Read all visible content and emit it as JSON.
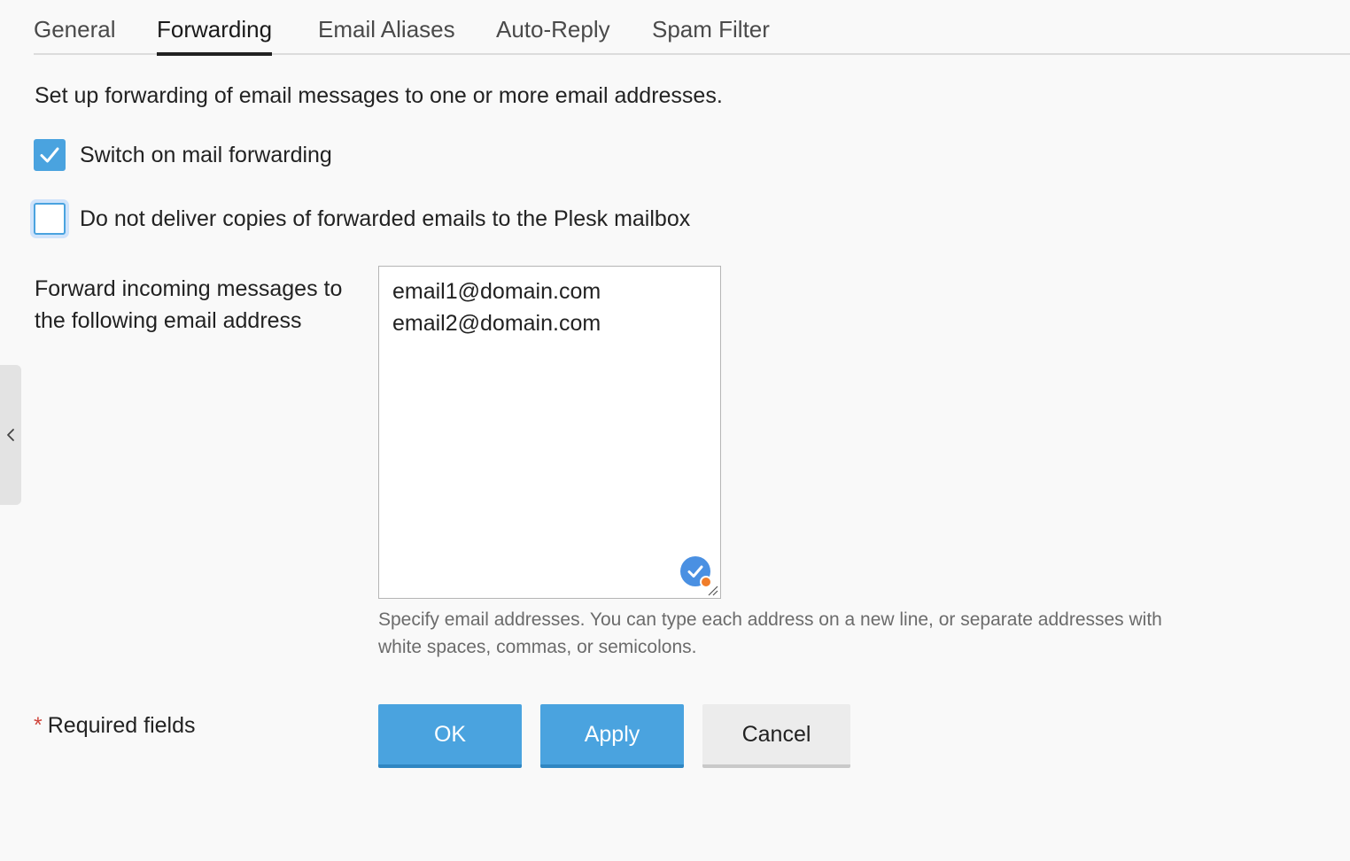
{
  "tabs": [
    {
      "label": "General",
      "active": false
    },
    {
      "label": "Forwarding",
      "active": true
    },
    {
      "label": "Email Aliases",
      "active": false
    },
    {
      "label": "Auto-Reply",
      "active": false
    },
    {
      "label": "Spam Filter",
      "active": false
    }
  ],
  "intro_text": "Set up forwarding of email messages to one or more email addresses.",
  "options": {
    "switch_forwarding": {
      "label": "Switch on mail forwarding",
      "checked": true
    },
    "no_copies": {
      "label": "Do not deliver copies of forwarded emails to the Plesk mailbox",
      "checked": false
    }
  },
  "forward_field": {
    "label": "Forward incoming messages to the following email address",
    "addresses": [
      "email1@domain.com",
      "email2@domain.com"
    ],
    "hint": "Specify email addresses. You can type each address on a new line, or separate addresses with white spaces, commas, or semicolons."
  },
  "required_note": {
    "star": "*",
    "text": "Required fields"
  },
  "buttons": {
    "ok": "OK",
    "apply": "Apply",
    "cancel": "Cancel"
  },
  "colors": {
    "accent": "#4aa3df",
    "required_star": "#d0463c",
    "badge_dot": "#f07d2a"
  },
  "icons": {
    "checkbox_check": "check-icon",
    "collapse_handle": "chevron-left-icon",
    "field_badge": "check-circle-icon"
  }
}
